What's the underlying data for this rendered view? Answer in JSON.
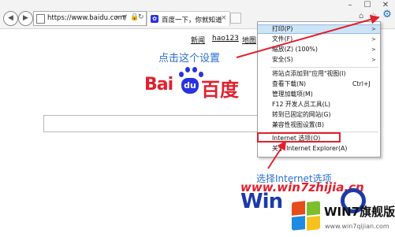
{
  "browser": {
    "window_controls": [
      "–",
      "☐",
      "✕"
    ],
    "address_url": "https://www.baidu.com/",
    "tab_title": "百度一下，你就知道",
    "tab_close": "×"
  },
  "page": {
    "nav_links": [
      "新闻",
      "hao123",
      "地图"
    ],
    "annotation_settings": "点击这个设置",
    "logo_bai": "Bai",
    "logo_du": "du",
    "logo_cn": "百度",
    "annotation_options": "选择Internet选项",
    "watermark_url": "www.win7zhijia.cn",
    "win_big": "Win",
    "win7_text": "WIN7旗舰版",
    "win7_url": "www.win7qijian.com"
  },
  "menu": {
    "items": [
      {
        "label": "打印(P)",
        "arrow": ">"
      },
      {
        "label": "文件(F)",
        "arrow": ">"
      },
      {
        "label": "缩放(Z) (100%)",
        "arrow": ">"
      },
      {
        "label": "安全(S)",
        "arrow": ">"
      },
      {
        "label": "将站点添加到\"应用\"视图(I)"
      },
      {
        "label": "查看下载(N)",
        "shortcut": "Ctrl+J"
      },
      {
        "label": "管理加载项(M)"
      },
      {
        "label": "F12 开发人员工具(L)"
      },
      {
        "label": "转到已固定的网站(G)"
      },
      {
        "label": "兼容性视图设置(B)"
      },
      {
        "label": "Internet 选项(O)"
      },
      {
        "label": "关于 Internet Explorer(A)"
      }
    ]
  },
  "colors": {
    "annotation_arrow": "#e0212e",
    "highlight": "#cde4f7",
    "baidu_red": "#e0212e",
    "baidu_blue": "#2932e1"
  },
  "icons": [
    "back-icon",
    "forward-icon",
    "search-icon",
    "refresh-icon",
    "lock-icon",
    "home-icon",
    "star-icon",
    "gear-icon"
  ]
}
